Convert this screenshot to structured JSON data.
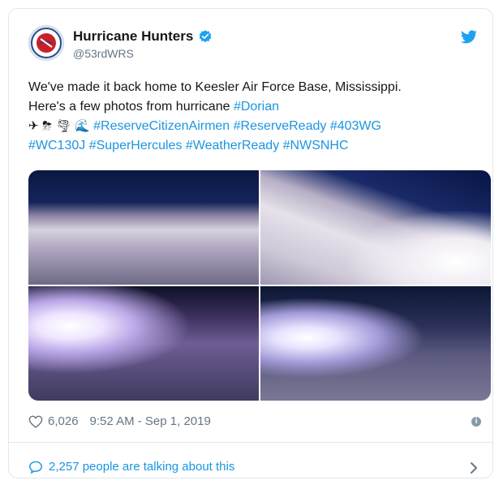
{
  "tweet": {
    "author": "Hurricane Hunters",
    "handle": "@53rdWRS",
    "text_line1": "We've made it back home to Keesler Air Force Base, Mississippi.",
    "text_line2_prefix": "Here's a few photos from hurricane ",
    "hashtag_dorian": "#Dorian",
    "emojis": [
      "✈",
      "⛈",
      "🌪",
      "🌊"
    ],
    "hashtags_line3": "#ReserveCitizenAirmen #ReserveReady #403WG",
    "hashtags_line4": "#WC130J #SuperHercules #WeatherReady #NWSNHC",
    "likes": "6,026",
    "timestamp": "9:52 AM - Sep 1, 2019",
    "talking": "2,257 people are talking about this"
  },
  "icons": {
    "verified": "verified-badge-icon",
    "bird": "twitter-bird-icon",
    "heart": "heart-icon",
    "info": "info-icon",
    "chat": "chat-bubble-icon",
    "chevron": "chevron-right-icon"
  },
  "colors": {
    "link": "#1b95e0",
    "text": "#14171a",
    "muted": "#657786"
  }
}
